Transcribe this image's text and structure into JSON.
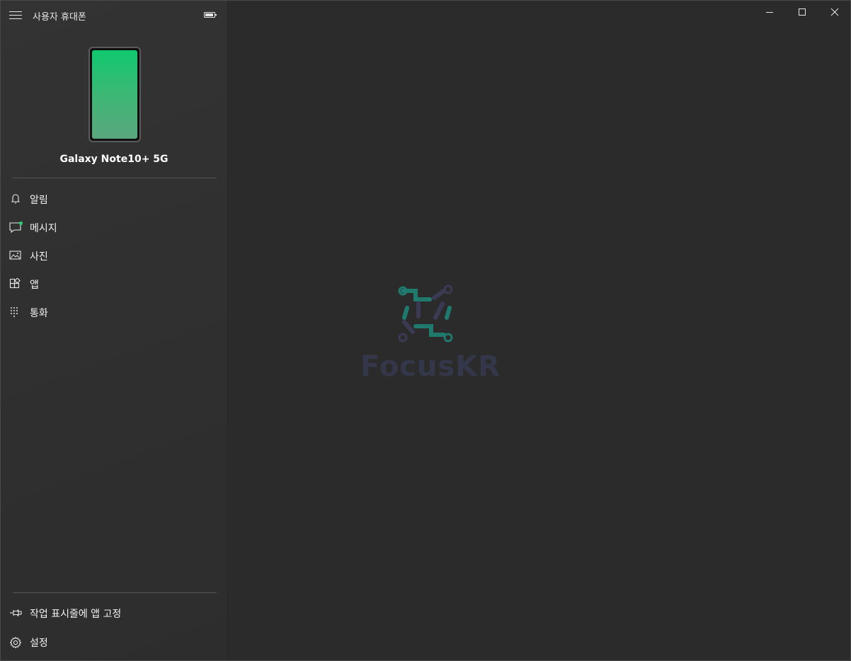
{
  "window": {
    "title": "사용자 휴대폰",
    "caption_buttons": [
      "minimize",
      "maximize",
      "close"
    ]
  },
  "device": {
    "name": "Galaxy Note10+ 5G",
    "battery_level": 0.9
  },
  "nav": {
    "items": [
      {
        "label": "알림",
        "icon": "bell-icon"
      },
      {
        "label": "메시지",
        "icon": "message-icon",
        "badge": true
      },
      {
        "label": "사진",
        "icon": "photo-icon"
      },
      {
        "label": "앱",
        "icon": "apps-icon"
      },
      {
        "label": "통화",
        "icon": "dialpad-icon"
      }
    ],
    "footer": [
      {
        "label": "작업 표시줄에 앱 고정",
        "icon": "pin-icon"
      },
      {
        "label": "설정",
        "icon": "gear-icon"
      }
    ]
  },
  "watermark": {
    "text": "FocusKR"
  },
  "colors": {
    "sidebar_bg": "#303030",
    "main_bg": "#2b2b2b",
    "accent": "#10c96e",
    "badge": "#2ecc71",
    "watermark_teal": "#1f7a6d",
    "watermark_navy": "#34374a"
  }
}
